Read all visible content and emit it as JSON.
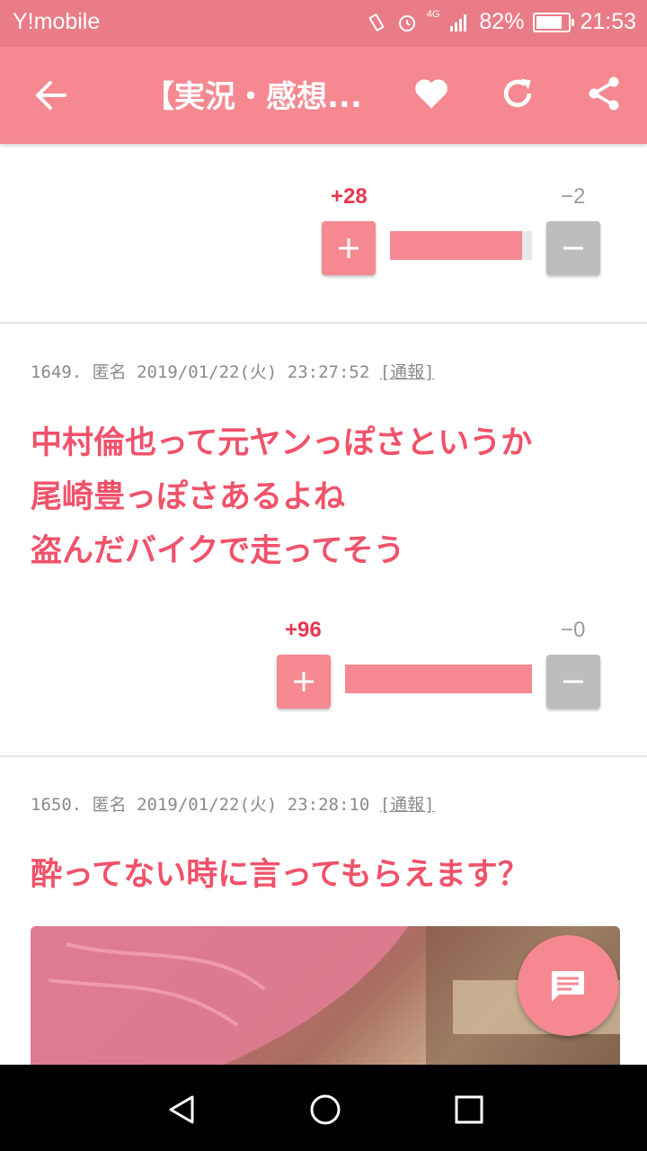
{
  "status": {
    "carrier": "Y!mobile",
    "network": "4G",
    "battery_pct": "82%",
    "battery_level": 0.82,
    "time": "21:53"
  },
  "header": {
    "title": "【実況・感想..."
  },
  "votes_top": {
    "plus": "+28",
    "minus": "−2",
    "ratio": 0.93
  },
  "comments": [
    {
      "meta": "1649. 匿名 2019/01/22(火) 23:27:52 ",
      "report": "[通報]",
      "lines": [
        "中村倫也って元ヤンっぽさというか",
        "尾崎豊っぽさあるよね",
        "盗んだバイクで走ってそう"
      ],
      "plus": "+96",
      "minus": "−0",
      "ratio": 1.0
    },
    {
      "meta": "1650. 匿名 2019/01/22(火) 23:28:10 ",
      "report": "[通報]",
      "lines": [
        "酔ってない時に言ってもらえます？"
      ]
    }
  ],
  "icons": {
    "back": "arrow-left-icon",
    "favorite": "heart-icon",
    "reload": "refresh-icon",
    "share": "share-icon",
    "plus": "plus-icon",
    "minus": "minus-icon",
    "fab": "comment-icon"
  },
  "colors": {
    "accent": "#f58891",
    "status_bar": "#e97c86",
    "comment_text": "#f0526a",
    "plus_count": "#e8364f"
  }
}
